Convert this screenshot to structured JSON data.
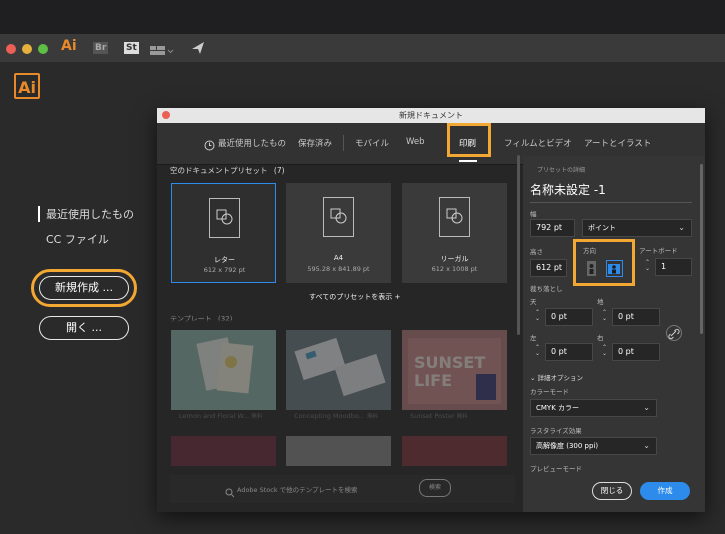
{
  "app": {
    "icons": [
      "Ai",
      "Br",
      "St"
    ],
    "logo": "Ai"
  },
  "home": {
    "nav": [
      "最近使用したもの",
      "CC ファイル"
    ],
    "new_button": "新規作成 ...",
    "open_button": "開く ..."
  },
  "dialog": {
    "title": "新規ドキュメント",
    "tabs": [
      "最近使用したもの",
      "保存済み",
      "モバイル",
      "Web",
      "印刷",
      "フィルムとビデオ",
      "アートとイラスト"
    ],
    "active_tab": "印刷",
    "presets_heading": "空のドキュメントプリセット",
    "presets_count": "(7)",
    "presets": [
      {
        "name": "レター",
        "size": "612 x 792 pt"
      },
      {
        "name": "A4",
        "size": "595.28 x 841.89 pt"
      },
      {
        "name": "リーガル",
        "size": "612 x 1008 pt"
      }
    ],
    "view_all": "すべてのプリセットを表示 +",
    "templates_heading": "テンプレート",
    "templates_count": "(32)",
    "templates": [
      {
        "name": "Lemon and Floral W...",
        "badge": "無料"
      },
      {
        "name": "Concepting Moodbo...",
        "badge": "無料"
      },
      {
        "name": "Sunset Poster",
        "badge": "無料"
      }
    ],
    "sunset_text": [
      "SUNSET",
      "LIFE"
    ],
    "stock_search": "Adobe Stock で他のテンプレートを検索",
    "stock_button": "検索",
    "details": {
      "section_label": "プリセットの詳細",
      "doc_name": "名称未設定 -1",
      "width_label": "幅",
      "width_value": "792 pt",
      "unit": "ポイント",
      "height_label": "高さ",
      "height_value": "612 pt",
      "orientation_label": "方向",
      "artboard_label": "アートボード",
      "artboard_value": "1",
      "bleed_label": "裁ち落とし",
      "top_label": "天",
      "bottom_label": "地",
      "left_label": "左",
      "right_label": "右",
      "top_value": "0 pt",
      "bottom_value": "0 pt",
      "left_value": "0 pt",
      "right_value": "0 pt",
      "advanced_label": "詳細オプション",
      "color_mode_label": "カラーモード",
      "color_mode_value": "CMYK カラー",
      "raster_label": "ラスタライズ効果",
      "raster_value": "高解像度 (300 ppi)",
      "preview_label": "プレビューモード"
    },
    "close_button": "閉じる",
    "create_button": "作成"
  },
  "colors": {
    "accent_blue": "#2d8ceb",
    "highlight_orange": "#f2a833",
    "ai_orange": "#e8892a"
  }
}
